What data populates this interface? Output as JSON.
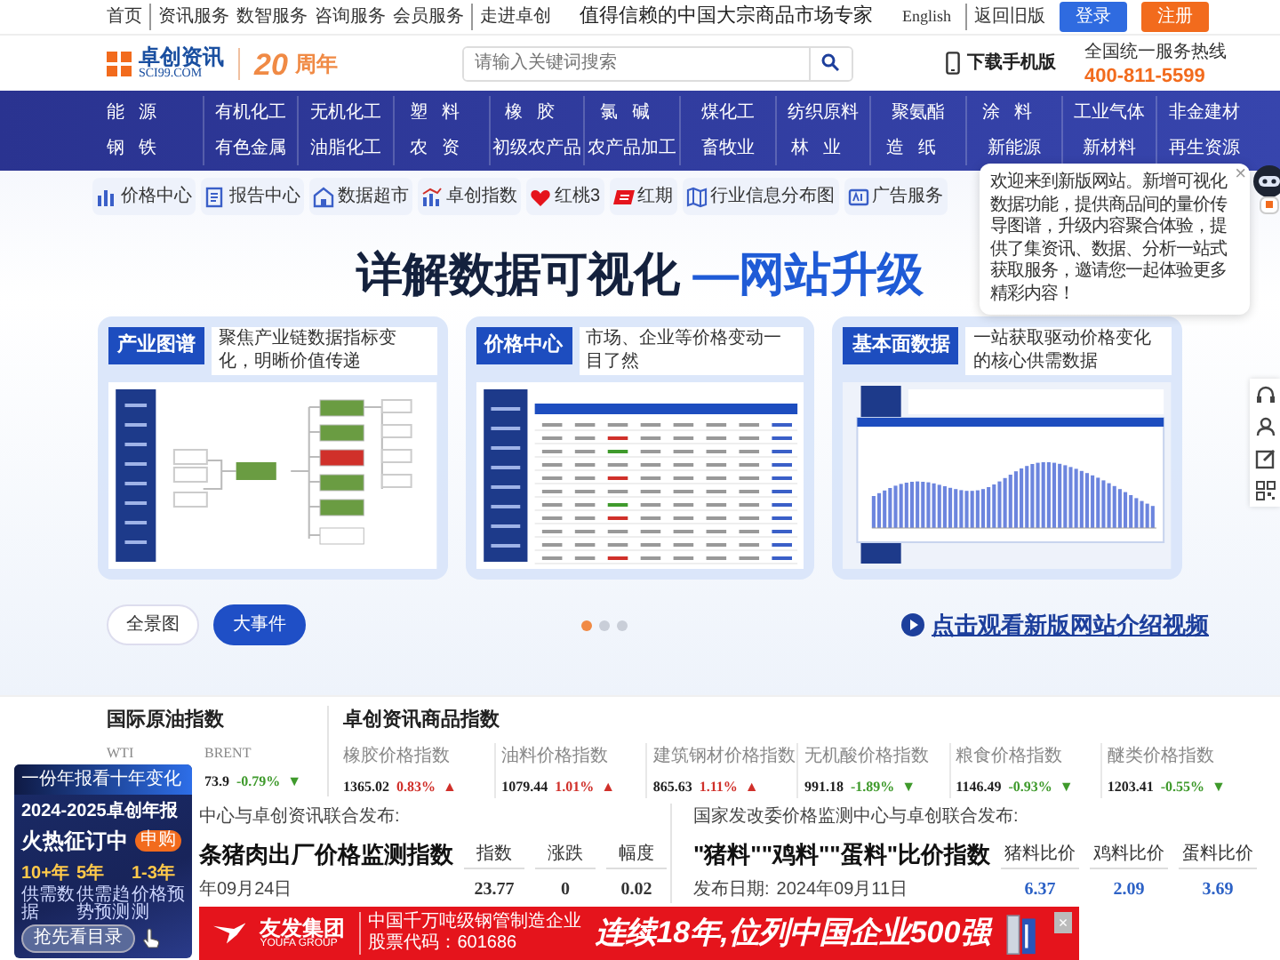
{
  "top_bar": {
    "links": [
      {
        "label": "首页",
        "divider": false
      },
      {
        "label": "资讯服务",
        "divider": true
      },
      {
        "label": "数智服务",
        "divider": false
      },
      {
        "label": "咨询服务",
        "divider": false
      },
      {
        "label": "会员服务",
        "divider": false
      },
      {
        "label": "走进卓创",
        "divider": true
      }
    ],
    "tagline": "值得信赖的中国大宗商品市场专家",
    "language": "English",
    "old_version": "返回旧版",
    "login": "登录",
    "register": "注册"
  },
  "header": {
    "logo_name": "卓创资讯",
    "logo_domain": "SCI99.COM",
    "anniversary_number": "20",
    "anniversary_text": "周年",
    "search": {
      "placeholder": "请输入关键词搜索"
    },
    "app_download": "下载手机版",
    "hotline_label": "全国统一服务热线",
    "hotline": "400-811-5599"
  },
  "category_rows": [
    [
      "能源",
      "有机化工",
      "无机化工",
      "塑料",
      "橡胶",
      "氯碱",
      "煤化工",
      "纺织原料",
      "聚氨酯",
      "涂料",
      "工业气体",
      "非金建材"
    ],
    [
      "钢铁",
      "有色金属",
      "油脂化工",
      "农资",
      "初级农产品",
      "农产品加工",
      "畜牧业",
      "林业",
      "造纸",
      "新能源",
      "新材料",
      "再生资源"
    ]
  ],
  "tools": [
    {
      "label": "价格中心",
      "kind": "bars"
    },
    {
      "label": "报告中心",
      "kind": "report"
    },
    {
      "label": "数据超市",
      "kind": "shop"
    },
    {
      "label": "卓创指数",
      "kind": "index"
    },
    {
      "label": "红桃3",
      "kind": "heart"
    },
    {
      "label": "红期",
      "kind": "brand"
    },
    {
      "label": "行业信息分布图",
      "kind": "map"
    },
    {
      "label": "广告服务",
      "kind": "ad"
    }
  ],
  "tooltip": {
    "text": "欢迎来到新版网站。新增可视化数据功能，提供商品间的量价传导图谱，升级内容聚合体验，提供了集资讯、数据、分析一站式获取服务，邀请您一起体验更多精彩内容！",
    "close": "×"
  },
  "hero": {
    "title": "详解数据可视化",
    "title_highlight": "—网站升级",
    "cards": [
      {
        "tag": "产业图谱",
        "caption": "聚焦产业链数据指标变化，明晰价值传递",
        "kind": "mindmap"
      },
      {
        "tag": "价格中心",
        "caption": "市场、企业等价格变动一目了然",
        "kind": "table"
      },
      {
        "tag": "基本面数据",
        "caption": "一站获取驱动价格变化的核心供需数据",
        "kind": "chart"
      }
    ],
    "buttons": [
      {
        "label": "全景图",
        "selected": false
      },
      {
        "label": "大事件",
        "selected": true
      }
    ],
    "dots": [
      {
        "selected": true
      },
      {
        "selected": false
      },
      {
        "selected": false
      }
    ],
    "video_link": "点击观看新版网站介绍视频"
  },
  "side_tools": [
    {
      "kind": "headset"
    },
    {
      "kind": "user"
    },
    {
      "kind": "edit"
    },
    {
      "kind": "qr"
    }
  ],
  "oil_index": {
    "title": "国际原油指数",
    "items": [
      {
        "name": "WTI"
      },
      {
        "name": "BRENT",
        "value": "73.9",
        "change": "-0.79%",
        "color": "#3f9a2c",
        "arrow": "▼"
      }
    ]
  },
  "commodity_index": {
    "title": "卓创资讯商品指数",
    "items": [
      {
        "name": "橡胶价格指数",
        "value": "1365.02",
        "change": "0.83%",
        "color": "#d0302a",
        "arrow": "▲"
      },
      {
        "name": "油料价格指数",
        "value": "1079.44",
        "change": "1.01%",
        "color": "#d0302a",
        "arrow": "▲"
      },
      {
        "name": "建筑钢材价格指数",
        "value": "865.63",
        "change": "1.11%",
        "color": "#d0302a",
        "arrow": "▲"
      },
      {
        "name": "无机酸价格指数",
        "value": "991.18",
        "change": "-1.89%",
        "color": "#3f9a2c",
        "arrow": "▼"
      },
      {
        "name": "粮食价格指数",
        "value": "1146.49",
        "change": "-0.93%",
        "color": "#3f9a2c",
        "arrow": "▼"
      },
      {
        "name": "醚类价格指数",
        "value": "1203.41",
        "change": "-0.55%",
        "color": "#3f9a2c",
        "arrow": "▼"
      }
    ]
  },
  "pork_index": {
    "source": "中心与卓创资讯联合发布:",
    "title": "条猪肉出厂价格监测指数",
    "date": "年09月24日",
    "columns": [
      "指数",
      "涨跌",
      "幅度"
    ],
    "values": [
      "23.77",
      "0",
      "0.02"
    ]
  },
  "feed_index": {
    "source": "国家发改委价格监测中心与卓创联合发布:",
    "title": "\"猪料\"\"鸡料\"\"蛋料\"比价指数",
    "date_label": "发布日期:",
    "date": "2024年09月11日",
    "columns": [
      "猪料比价",
      "鸡料比价",
      "蛋料比价"
    ],
    "values": [
      "6.37",
      "2.09",
      "3.69"
    ]
  },
  "annual_ad": {
    "tagline": "一份年报看十年变化",
    "year": "2024-2025卓创年报",
    "headline": "火热征订中",
    "badge": "申购",
    "features": [
      {
        "number": "10+年",
        "label": "供需数据"
      },
      {
        "number": "5年",
        "label": "供需趋势预测"
      },
      {
        "number": "1-3年",
        "label": "价格预测"
      }
    ],
    "button": "抢先看目录"
  },
  "banner": {
    "brand": "友发集团",
    "brand_en": "YOUFA GROUP",
    "tagline": "中国千万吨级钢管制造企业",
    "stock": "股票代码：601686",
    "slogan": "连续18年,位列中国企业500强",
    "close": "×"
  }
}
